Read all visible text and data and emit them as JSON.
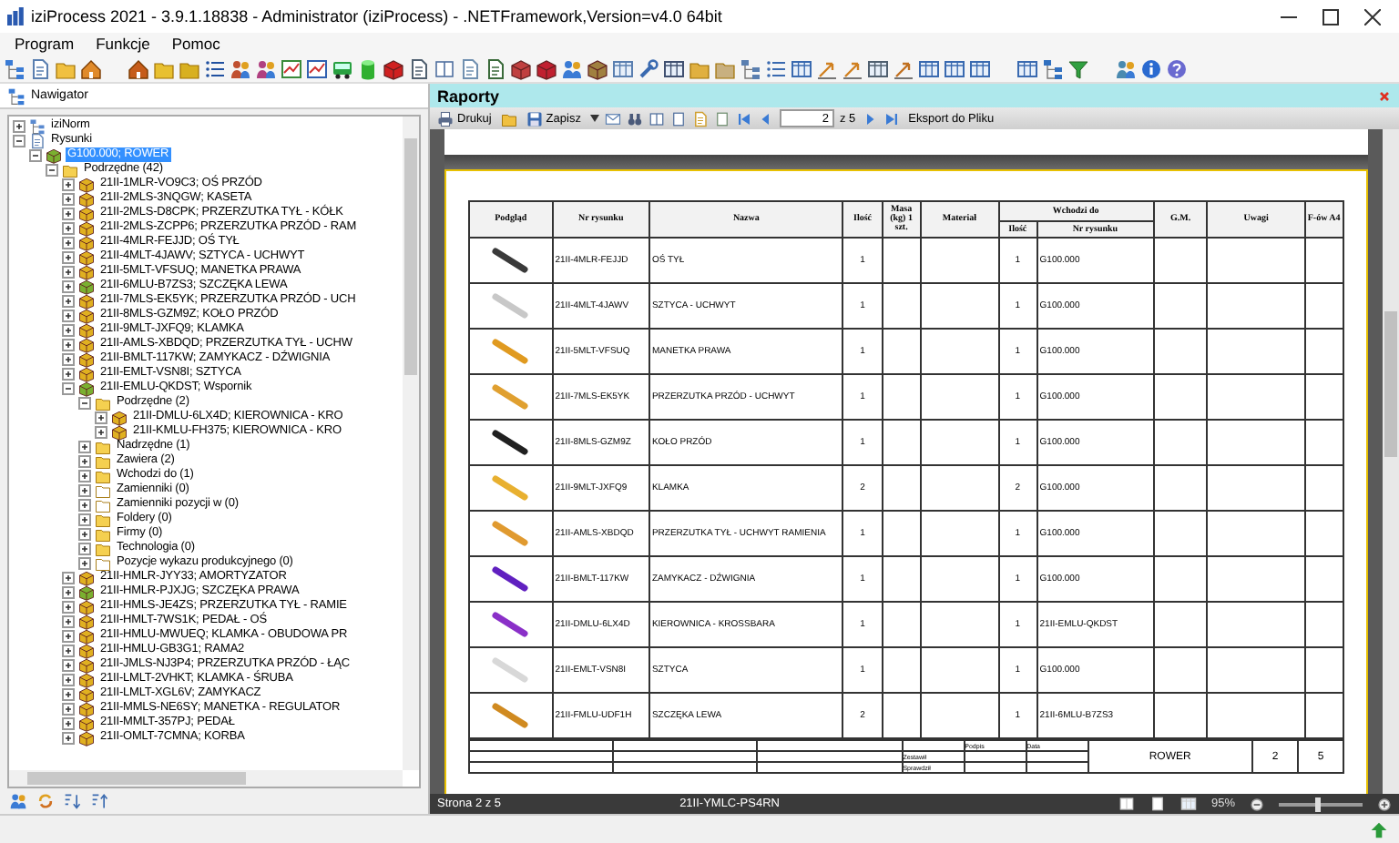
{
  "window": {
    "title": "iziProcess 2021 - 3.9.1.18838 - Administrator (iziProcess) - .NETFramework,Version=v4.0 64bit"
  },
  "menu": [
    "Program",
    "Funkcje",
    "Pomoc"
  ],
  "navigator": {
    "title": "Nawigator",
    "tree": [
      {
        "label": "iziNorm",
        "kind": "library",
        "expanded": false,
        "selected": false
      },
      {
        "label": "Rysunki",
        "kind": "drawings",
        "expanded": true,
        "selected": false,
        "children": [
          {
            "label": "G100.000; ROWER",
            "kind": "assembly",
            "expanded": true,
            "selected": true,
            "children": [
              {
                "label": "Podrzędne (42)",
                "kind": "folder",
                "expanded": true,
                "selected": false,
                "children": [
                  {
                    "label": "21II-1MLR-VO9C3; OŚ PRZÓD",
                    "kind": "part",
                    "expanded": false,
                    "selected": false
                  },
                  {
                    "label": "21II-2MLS-3NQGW; KASETA",
                    "kind": "part",
                    "expanded": false,
                    "selected": false
                  },
                  {
                    "label": "21II-2MLS-D8CPK; PRZERZUTKA TYŁ - KÓŁK",
                    "kind": "part",
                    "expanded": false,
                    "selected": false
                  },
                  {
                    "label": "21II-2MLS-ZCPP6; PRZERZUTKA PRZÓD - RAM",
                    "kind": "part",
                    "expanded": false,
                    "selected": false
                  },
                  {
                    "label": "21II-4MLR-FEJJD; OŚ TYŁ",
                    "kind": "part",
                    "expanded": false,
                    "selected": false
                  },
                  {
                    "label": "21II-4MLT-4JAWV; SZTYCA - UCHWYT",
                    "kind": "part",
                    "expanded": false,
                    "selected": false
                  },
                  {
                    "label": "21II-5MLT-VFSUQ; MANETKA PRAWA",
                    "kind": "part",
                    "expanded": false,
                    "selected": false
                  },
                  {
                    "label": "21II-6MLU-B7ZS3; SZCZĘKA LEWA",
                    "kind": "assembly",
                    "expanded": false,
                    "selected": false
                  },
                  {
                    "label": "21II-7MLS-EK5YK; PRZERZUTKA PRZÓD - UCH",
                    "kind": "part",
                    "expanded": false,
                    "selected": false
                  },
                  {
                    "label": "21II-8MLS-GZM9Z; KOŁO PRZÓD",
                    "kind": "part",
                    "expanded": false,
                    "selected": false
                  },
                  {
                    "label": "21II-9MLT-JXFQ9; KLAMKA",
                    "kind": "part",
                    "expanded": false,
                    "selected": false
                  },
                  {
                    "label": "21II-AMLS-XBDQD; PRZERZUTKA TYŁ - UCHW",
                    "kind": "part",
                    "expanded": false,
                    "selected": false
                  },
                  {
                    "label": "21II-BMLT-117KW; ZAMYKACZ - DŹWIGNIA",
                    "kind": "part",
                    "expanded": false,
                    "selected": false
                  },
                  {
                    "label": "21II-EMLT-VSN8I; SZTYCA",
                    "kind": "part",
                    "expanded": false,
                    "selected": false
                  },
                  {
                    "label": "21II-EMLU-QKDST; Wspornik",
                    "kind": "assembly",
                    "expanded": true,
                    "selected": false,
                    "children": [
                      {
                        "label": "Podrzędne (2)",
                        "kind": "folder",
                        "expanded": true,
                        "selected": false,
                        "children": [
                          {
                            "label": "21II-DMLU-6LX4D; KIEROWNICA - KRO",
                            "kind": "part",
                            "expanded": false,
                            "selected": false
                          },
                          {
                            "label": "21II-KMLU-FH375; KIEROWNICA - KRO",
                            "kind": "part",
                            "expanded": false,
                            "selected": false
                          }
                        ]
                      },
                      {
                        "label": "Nadrzędne (1)",
                        "kind": "folder",
                        "expanded": false,
                        "selected": false
                      },
                      {
                        "label": "Zawiera (2)",
                        "kind": "folder",
                        "expanded": false,
                        "selected": false
                      },
                      {
                        "label": "Wchodzi do (1)",
                        "kind": "folder",
                        "expanded": false,
                        "selected": false
                      },
                      {
                        "label": "Zamienniki (0)",
                        "kind": "empty-folder",
                        "expanded": false,
                        "selected": false
                      },
                      {
                        "label": "Zamienniki pozycji w (0)",
                        "kind": "empty-folder",
                        "expanded": false,
                        "selected": false
                      },
                      {
                        "label": "Foldery (0)",
                        "kind": "folder",
                        "expanded": false,
                        "selected": false
                      },
                      {
                        "label": "Firmy (0)",
                        "kind": "folder",
                        "expanded": false,
                        "selected": false
                      },
                      {
                        "label": "Technologia (0)",
                        "kind": "folder",
                        "expanded": false,
                        "selected": false
                      },
                      {
                        "label": "Pozycje wykazu produkcyjnego (0)",
                        "kind": "empty-folder",
                        "expanded": false,
                        "selected": false
                      }
                    ]
                  },
                  {
                    "label": "21II-HMLR-JYY33; AMORTYZATOR",
                    "kind": "part",
                    "expanded": false,
                    "selected": false
                  },
                  {
                    "label": "21II-HMLR-PJXJG; SZCZĘKA PRAWA",
                    "kind": "assembly",
                    "expanded": false,
                    "selected": false
                  },
                  {
                    "label": "21II-HMLS-JE4ZS; PRZERZUTKA TYŁ - RAMIE",
                    "kind": "part",
                    "expanded": false,
                    "selected": false
                  },
                  {
                    "label": "21II-HMLT-7WS1K; PEDAŁ - OŚ",
                    "kind": "part",
                    "expanded": false,
                    "selected": false
                  },
                  {
                    "label": "21II-HMLU-MWUEQ; KLAMKA - OBUDOWA PR",
                    "kind": "part",
                    "expanded": false,
                    "selected": false
                  },
                  {
                    "label": "21II-HMLU-GB3G1; RAMA2",
                    "kind": "part",
                    "expanded": false,
                    "selected": false
                  },
                  {
                    "label": "21II-JMLS-NJ3P4; PRZERZUTKA PRZÓD - ŁĄC",
                    "kind": "part",
                    "expanded": false,
                    "selected": false
                  },
                  {
                    "label": "21II-LMLT-2VHKT; KLAMKA - ŚRUBA",
                    "kind": "part",
                    "expanded": false,
                    "selected": false
                  },
                  {
                    "label": "21II-LMLT-XGL6V; ZAMYKACZ",
                    "kind": "part",
                    "expanded": false,
                    "selected": false
                  },
                  {
                    "label": "21II-MMLS-NE6SY; MANETKA - REGULATOR",
                    "kind": "part",
                    "expanded": false,
                    "selected": false
                  },
                  {
                    "label": "21II-MMLT-357PJ; PEDAŁ",
                    "kind": "part",
                    "expanded": false,
                    "selected": false
                  },
                  {
                    "label": "21II-OMLT-7CMNA; KORBA",
                    "kind": "part",
                    "expanded": false,
                    "selected": false
                  }
                ]
              }
            ]
          }
        ]
      }
    ]
  },
  "report": {
    "title": "Raporty",
    "toolbar": {
      "print": "Drukuj",
      "save": "Zapisz",
      "page": "2",
      "page_total": "z 5",
      "export": "Eksport do Pliku"
    },
    "table": {
      "columns": [
        {
          "label": "Podgląd"
        },
        {
          "label": "Nr rysunku"
        },
        {
          "label": "Nazwa"
        },
        {
          "label": "Ilość"
        },
        {
          "label": "Masa (kg) 1 szt."
        },
        {
          "label": "Materiał"
        },
        {
          "label": "Wchodzi do",
          "children": [
            {
              "label": "Ilość"
            },
            {
              "label": "Nr rysunku"
            }
          ]
        },
        {
          "label": "G.M."
        },
        {
          "label": "Uwagi"
        },
        {
          "label": "F-ów A4"
        }
      ],
      "rows": [
        {
          "color": "#3a3a3a",
          "drawing_no": "21II-4MLR-FEJJD",
          "name": "OŚ TYŁ",
          "qty": "1",
          "parent_qty": "1",
          "parent_drawing": "G100.000"
        },
        {
          "color": "#c8c8c8",
          "drawing_no": "21II-4MLT-4JAWV",
          "name": "SZTYCA - UCHWYT",
          "qty": "1",
          "parent_qty": "1",
          "parent_drawing": "G100.000"
        },
        {
          "color": "#e09a20",
          "drawing_no": "21II-5MLT-VFSUQ",
          "name": "MANETKA PRAWA",
          "qty": "1",
          "parent_qty": "1",
          "parent_drawing": "G100.000"
        },
        {
          "color": "#e0a030",
          "drawing_no": "21II-7MLS-EK5YK",
          "name": "PRZERZUTKA PRZÓD - UCHWYT",
          "qty": "1",
          "parent_qty": "1",
          "parent_drawing": "G100.000"
        },
        {
          "color": "#202020",
          "drawing_no": "21II-8MLS-GZM9Z",
          "name": "KOŁO PRZÓD",
          "qty": "1",
          "parent_qty": "1",
          "parent_drawing": "G100.000"
        },
        {
          "color": "#e8b030",
          "drawing_no": "21II-9MLT-JXFQ9",
          "name": "KLAMKA",
          "qty": "2",
          "parent_qty": "2",
          "parent_drawing": "G100.000"
        },
        {
          "color": "#e09a30",
          "drawing_no": "21II-AMLS-XBDQD",
          "name": "PRZERZUTKA TYŁ - UCHWYT RAMIENIA",
          "qty": "1",
          "parent_qty": "1",
          "parent_drawing": "G100.000"
        },
        {
          "color": "#6020c0",
          "drawing_no": "21II-BMLT-117KW",
          "name": "ZAMYKACZ - DŹWIGNIA",
          "qty": "1",
          "parent_qty": "1",
          "parent_drawing": "G100.000"
        },
        {
          "color": "#8a30c8",
          "drawing_no": "21II-DMLU-6LX4D",
          "name": "KIEROWNICA - KROSSBARA",
          "qty": "1",
          "parent_qty": "1",
          "parent_drawing": "21II-EMLU-QKDST"
        },
        {
          "color": "#d8d8d8",
          "drawing_no": "21II-EMLT-VSN8I",
          "name": "SZTYCA",
          "qty": "1",
          "parent_qty": "1",
          "parent_drawing": "G100.000"
        },
        {
          "color": "#d08a20",
          "drawing_no": "21II-FMLU-UDF1H",
          "name": "SZCZĘKA LEWA",
          "qty": "2",
          "parent_qty": "1",
          "parent_drawing": "21II-6MLU-B7ZS3"
        }
      ]
    },
    "title_block": {
      "made_by": "Zestawił",
      "checked_by": "Sprawdził",
      "signature": "Podpis",
      "date": "Data",
      "group": "ROWER",
      "sheet": "2",
      "sheets": "5"
    },
    "status": {
      "page": "Strona 2 z 5",
      "drawing": "21II-YMLC-PS4RN",
      "zoom": "95%",
      "level": 0.47
    }
  }
}
